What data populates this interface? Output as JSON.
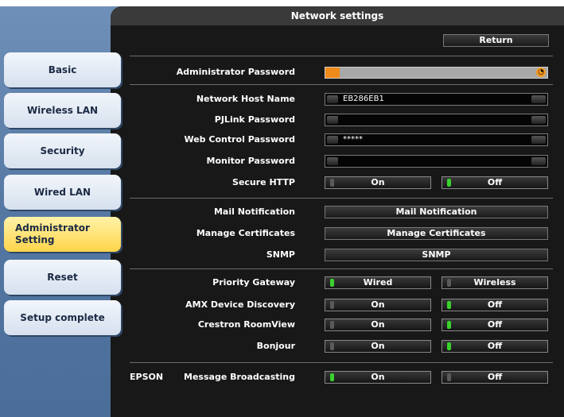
{
  "title": "Network settings",
  "return_label": "Return",
  "sidebar": {
    "items": [
      {
        "label": "Basic"
      },
      {
        "label": "Wireless LAN"
      },
      {
        "label": "Security"
      },
      {
        "label": "Wired LAN"
      },
      {
        "label": "Administrator Setting",
        "line1": "Administrator",
        "line2": "Setting",
        "active": true
      },
      {
        "label": "Reset"
      },
      {
        "label": "Setup complete"
      }
    ]
  },
  "settings": {
    "admin_password": {
      "label": "Administrator Password"
    },
    "network_host_name": {
      "label": "Network Host Name",
      "value": "EB286EB1"
    },
    "pjlink_password": {
      "label": "PJLink Password",
      "value": ""
    },
    "web_control_password": {
      "label": "Web Control Password",
      "value": "*****"
    },
    "monitor_password": {
      "label": "Monitor Password",
      "value": ""
    },
    "secure_http": {
      "label": "Secure HTTP",
      "on": "On",
      "off": "Off",
      "selected": "Off"
    },
    "mail_notification": {
      "label": "Mail Notification",
      "button": "Mail Notification"
    },
    "manage_certificates": {
      "label": "Manage Certificates",
      "button": "Manage Certificates"
    },
    "snmp": {
      "label": "SNMP",
      "button": "SNMP"
    },
    "priority_gateway": {
      "label": "Priority Gateway",
      "opt1": "Wired",
      "opt2": "Wireless",
      "selected": "Wired"
    },
    "amx": {
      "label": "AMX Device Discovery",
      "on": "On",
      "off": "Off",
      "selected": "Off"
    },
    "crestron": {
      "label": "Crestron RoomView",
      "on": "On",
      "off": "Off",
      "selected": "Off"
    },
    "bonjour": {
      "label": "Bonjour",
      "on": "On",
      "off": "Off",
      "selected": "Off"
    },
    "message_broadcasting": {
      "prefix": "EPSON",
      "label": "Message Broadcasting",
      "on": "On",
      "off": "Off",
      "selected": "On"
    }
  },
  "colors": {
    "active_tab": "#ffd44a",
    "indicator_on": "#3ad12d",
    "admin_fill": "#f08a1a"
  }
}
